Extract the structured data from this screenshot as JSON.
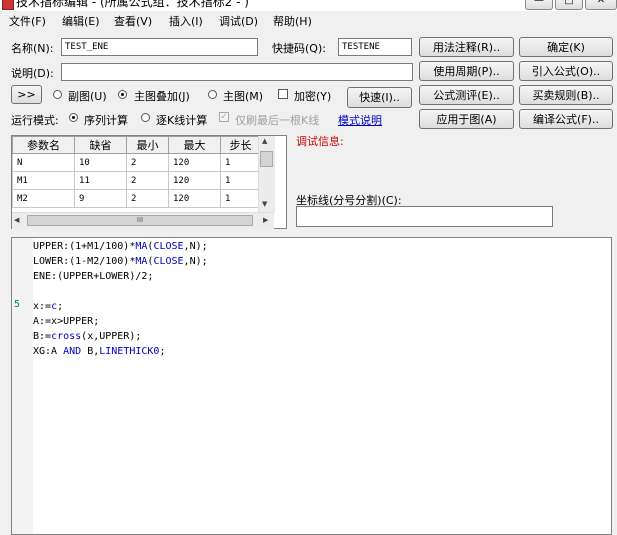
{
  "window": {
    "title": "技术指标编辑 - (所属公式组：技术指标2 - )",
    "buttons": [
      "—",
      "□",
      "✕"
    ]
  },
  "menu": [
    "文件(F)",
    "编辑(E)",
    "查看(V)",
    "插入(I)",
    "调试(D)",
    "帮助(H)"
  ],
  "form": {
    "name_label": "名称(N):",
    "name_value": "TEST_ENE",
    "hotkey_label": "快捷码(Q):",
    "hotkey_value": "TESTENE",
    "desc_label": "说明(D):",
    "desc_value": "",
    "expand_button": ">>",
    "radio_sub": "副图(U)",
    "radio_main_overlay": "主图叠加(J)",
    "radio_main": "主图(M)",
    "check_encrypt": "加密(Y)",
    "quick_button": "快速(I)..",
    "run_mode_label": "运行模式:",
    "radio_sequence": "序列计算",
    "radio_per_k": "逐K线计算",
    "check_last_k": "仅刷最后一根K线",
    "mode_link": "模式说明"
  },
  "right_buttons": {
    "usage_notes": "用法注释(R)..",
    "confirm": "确定(K)",
    "usage_period": "使用周期(P)..",
    "import_formula": "引入公式(O)..",
    "formula_test": "公式测评(E)..",
    "trade_rules": "买卖规则(B)..",
    "apply_to_chart": "应用于图(A)",
    "compile_formula": "编译公式(F).."
  },
  "params": {
    "headers": [
      "参数名",
      "缺省",
      "最小",
      "最大",
      "步长"
    ],
    "rows": [
      [
        "N",
        "10",
        "2",
        "120",
        "1"
      ],
      [
        "M1",
        "11",
        "2",
        "120",
        "1"
      ],
      [
        "M2",
        "9",
        "2",
        "120",
        "1"
      ]
    ]
  },
  "scroll_glyphs": {
    "up": "▲",
    "down": "▼",
    "left": "◀",
    "right": "▶",
    "thumb": "III"
  },
  "debug_label": "调试信息:",
  "axis_label": "坐标线(分号分割)(C):",
  "axis_value": "",
  "editor": {
    "line_number": "5",
    "code": [
      [
        {
          "t": "UPPER:(1+M1/100)*"
        },
        {
          "t": "MA",
          "kw": true
        },
        {
          "t": "("
        },
        {
          "t": "CLOSE",
          "kw": true
        },
        {
          "t": ",N);"
        }
      ],
      [
        {
          "t": "LOWER:(1-M2/100)*"
        },
        {
          "t": "MA",
          "kw": true
        },
        {
          "t": "("
        },
        {
          "t": "CLOSE",
          "kw": true
        },
        {
          "t": ",N);"
        }
      ],
      [
        {
          "t": "ENE:(UPPER+LOWER)/2;"
        }
      ],
      [],
      [
        {
          "t": "x:="
        },
        {
          "t": "c",
          "kw": true
        },
        {
          "t": ";"
        }
      ],
      [
        {
          "t": "A:=x>UPPER;"
        }
      ],
      [
        {
          "t": "B:="
        },
        {
          "t": "cross",
          "kw": true
        },
        {
          "t": "(x,UPPER);"
        }
      ],
      [
        {
          "t": "XG:A "
        },
        {
          "t": "AND",
          "kw": true
        },
        {
          "t": " B,"
        },
        {
          "t": "LINETHICK0",
          "kw": true
        },
        {
          "t": ";"
        }
      ]
    ]
  },
  "colors": {
    "keyword": "#0000cc",
    "debug": "#cc0000",
    "link": "#0000cc",
    "line_number": "#008080"
  }
}
